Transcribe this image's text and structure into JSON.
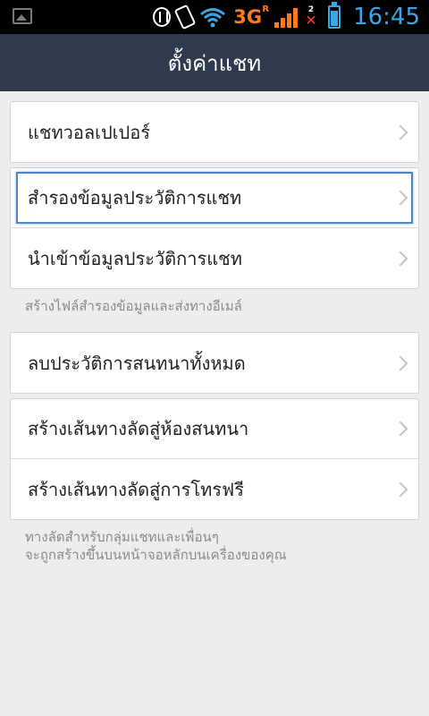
{
  "status_bar": {
    "network": "3G",
    "roaming": "R",
    "sim_slot": "2",
    "time": "16:45",
    "battery_color": "#3aa6e3",
    "network_color": "#ff7a1c",
    "icons": [
      "image-notification-icon",
      "sync-icon",
      "vibrate-icon",
      "wifi-icon",
      "signal-icon",
      "no-sim-icon",
      "battery-icon"
    ]
  },
  "header": {
    "title": "ตั้งค่าแชท",
    "background": "#2f3a4e"
  },
  "groups": [
    {
      "items": [
        {
          "label": "แชทวอลเปเปอร์"
        }
      ]
    },
    {
      "items": [
        {
          "label": "สำรองข้อมูลประวัติการแชท",
          "focused": true
        },
        {
          "label": "นำเข้าข้อมูลประวัติการแชท"
        }
      ],
      "note": "สร้างไฟล์สำรองข้อมูลและส่งทางอีเมล์"
    },
    {
      "items": [
        {
          "label": "ลบประวัติการสนทนาทั้งหมด"
        }
      ]
    },
    {
      "items": [
        {
          "label": "สร้างเส้นทางลัดสู่ห้องสนทนา"
        },
        {
          "label": "สร้างเส้นทางลัดสู่การโทรฟรี"
        }
      ],
      "note_lines": [
        "ทางลัดสำหรับกลุ่มแชทและเพื่อนๆ",
        "จะถูกสร้างขึ้นบนหน้าจอหลักบนเครื่องของคุณ"
      ]
    }
  ]
}
